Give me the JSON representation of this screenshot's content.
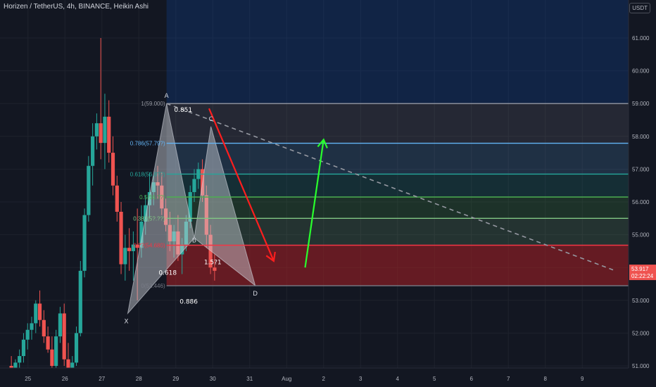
{
  "header": {
    "title": "Horizen / TetherUS, 4h, BINANCE, Heikin Ashi",
    "currency_badge": "USDT"
  },
  "colors": {
    "background": "#131722",
    "bull": "#26a69a",
    "bear": "#ef5350",
    "grid": "#1e222d",
    "text": "#b2b5be"
  },
  "price_badge": {
    "price": "53.917",
    "countdown": "02:22:24",
    "color": "#ef5350"
  },
  "chart_data": {
    "type": "candlestick",
    "style": "Heikin Ashi",
    "ylim": [
      50.6,
      62.0
    ],
    "y_ticks": [
      "51.000",
      "52.000",
      "53.000",
      "54.000",
      "55.000",
      "56.000",
      "57.000",
      "58.000",
      "59.000",
      "60.000",
      "61.000"
    ],
    "x_ticks": [
      {
        "label": "25",
        "x": -12.5
      },
      {
        "label": "26",
        "x": -11.5
      },
      {
        "label": "27",
        "x": -10.5
      },
      {
        "label": "28",
        "x": -9.5
      },
      {
        "label": "29",
        "x": -8.5
      },
      {
        "label": "30",
        "x": -7.5
      },
      {
        "label": "31",
        "x": -6.5
      },
      {
        "label": "Aug",
        "x": -5.5
      },
      {
        "label": "2",
        "x": -4.5
      },
      {
        "label": "3",
        "x": -3.5
      },
      {
        "label": "4",
        "x": -2.5
      },
      {
        "label": "5",
        "x": -1.5
      },
      {
        "label": "6",
        "x": -0.5
      },
      {
        "label": "7",
        "x": 0.5
      },
      {
        "label": "8",
        "x": 1.5
      },
      {
        "label": "9",
        "x": 2.5
      }
    ],
    "candles": [
      [
        51.0,
        51.3,
        50.7,
        50.8
      ],
      [
        50.8,
        51.2,
        50.6,
        51.1
      ],
      [
        51.1,
        51.5,
        50.8,
        51.3
      ],
      [
        51.3,
        52.0,
        51.1,
        51.8
      ],
      [
        51.8,
        52.3,
        51.5,
        52.1
      ],
      [
        52.1,
        52.5,
        51.8,
        52.3
      ],
      [
        52.3,
        53.0,
        52.0,
        52.9
      ],
      [
        52.9,
        53.3,
        52.2,
        52.4
      ],
      [
        52.4,
        52.7,
        51.7,
        51.9
      ],
      [
        51.9,
        52.2,
        51.4,
        51.5
      ],
      [
        51.5,
        51.9,
        50.8,
        51.0
      ],
      [
        51.0,
        52.1,
        50.9,
        51.9
      ],
      [
        51.9,
        52.8,
        51.7,
        52.6
      ],
      [
        52.6,
        52.9,
        51.0,
        51.2
      ],
      [
        51.2,
        51.7,
        50.6,
        50.9
      ],
      [
        50.9,
        51.3,
        50.6,
        51.1
      ],
      [
        51.1,
        52.2,
        51.0,
        52.0
      ],
      [
        52.0,
        54.2,
        51.9,
        53.9
      ],
      [
        53.9,
        55.8,
        53.7,
        55.6
      ],
      [
        55.6,
        57.4,
        55.4,
        57.1
      ],
      [
        57.1,
        58.4,
        56.5,
        58.0
      ],
      [
        58.0,
        58.7,
        57.6,
        58.4
      ],
      [
        58.4,
        61.0,
        57.3,
        57.8
      ],
      [
        57.8,
        59.3,
        57.0,
        58.6
      ],
      [
        58.6,
        59.1,
        57.2,
        57.5
      ],
      [
        57.5,
        58.0,
        56.2,
        56.5
      ],
      [
        56.5,
        56.8,
        55.4,
        55.7
      ],
      [
        55.7,
        56.0,
        53.8,
        54.1
      ],
      [
        54.1,
        55.0,
        53.6,
        54.6
      ],
      [
        54.6,
        55.2,
        53.9,
        54.5
      ],
      [
        54.5,
        55.1,
        53.6,
        54.7
      ],
      [
        54.7,
        55.8,
        53.0,
        54.6
      ],
      [
        54.6,
        55.9,
        54.3,
        55.4
      ],
      [
        55.4,
        56.2,
        55.0,
        55.9
      ],
      [
        55.9,
        56.9,
        55.5,
        56.3
      ],
      [
        56.3,
        56.8,
        55.9,
        56.6
      ],
      [
        56.6,
        57.1,
        56.1,
        56.5
      ],
      [
        56.5,
        56.9,
        55.6,
        55.8
      ],
      [
        55.8,
        56.1,
        55.1,
        55.3
      ],
      [
        55.3,
        55.7,
        54.5,
        54.8
      ],
      [
        54.8,
        55.3,
        54.3,
        55.1
      ],
      [
        55.1,
        55.6,
        54.2,
        54.4
      ],
      [
        54.4,
        54.9,
        53.8,
        54.7
      ],
      [
        54.7,
        55.6,
        54.5,
        55.4
      ],
      [
        55.4,
        56.5,
        55.2,
        56.3
      ],
      [
        56.3,
        57.0,
        56.0,
        56.7
      ],
      [
        56.7,
        57.2,
        56.4,
        57.0
      ],
      [
        57.0,
        57.3,
        56.0,
        56.2
      ],
      [
        56.2,
        56.5,
        54.6,
        55.0
      ],
      [
        55.0,
        55.3,
        53.8,
        54.0
      ],
      [
        54.0,
        54.4,
        53.6,
        53.9
      ]
    ],
    "fib_levels": [
      {
        "ratio": "1",
        "price": 59.0,
        "label": "1(59.000)",
        "color": "#9598a1"
      },
      {
        "ratio": "0.786",
        "price": 57.79,
        "label": "0.786(57.79?)",
        "color": "#64b5f6"
      },
      {
        "ratio": "0.618",
        "price": 56.85,
        "label": "0.618(56.8??)",
        "color": "#26a69a"
      },
      {
        "ratio": "0.5",
        "price": 56.15,
        "label": "0.5(56.??)",
        "color": "#4caf50"
      },
      {
        "ratio": "0.382",
        "price": 55.5,
        "label": "0.382(5?.??)",
        "color": "#81c784"
      },
      {
        "ratio": "0.236",
        "price": 54.68,
        "label": "0.2?(54.680)",
        "color": "#f23645"
      },
      {
        "ratio": "0",
        "price": 53.446,
        "label": "0(53.446)",
        "color": "#787b86"
      }
    ],
    "harmonic_points": [
      {
        "label": "X",
        "x": -9.8,
        "y": 52.6
      },
      {
        "label": "A",
        "x": -8.75,
        "y": 59.0
      },
      {
        "label": "B",
        "x": -8.0,
        "y": 54.9
      },
      {
        "label": "C",
        "x": -7.55,
        "y": 58.3
      },
      {
        "label": "D",
        "x": -6.35,
        "y": 53.45
      }
    ],
    "harmonic_ratios": [
      {
        "label": "0.851",
        "x": -8.3,
        "y": 58.75
      },
      {
        "label": "0.618",
        "x": -8.72,
        "y": 53.78
      },
      {
        "label": "1.5?1",
        "x": -7.5,
        "y": 54.1
      },
      {
        "label": "0.886",
        "x": -8.15,
        "y": 52.9
      }
    ],
    "trendline": {
      "x1": -8.75,
      "y1": 59.0,
      "x2": 3.4,
      "y2": 53.9,
      "style": "dashed"
    },
    "arrows": [
      {
        "name": "bearish-projection",
        "x1": -7.6,
        "y1": 58.85,
        "x2": -5.85,
        "y2": 54.2,
        "color": "#ff1e1e"
      },
      {
        "name": "bullish-projection",
        "x1": -5.0,
        "y1": 54.0,
        "x2": -4.5,
        "y2": 57.9,
        "color": "#29ff2d"
      }
    ]
  }
}
